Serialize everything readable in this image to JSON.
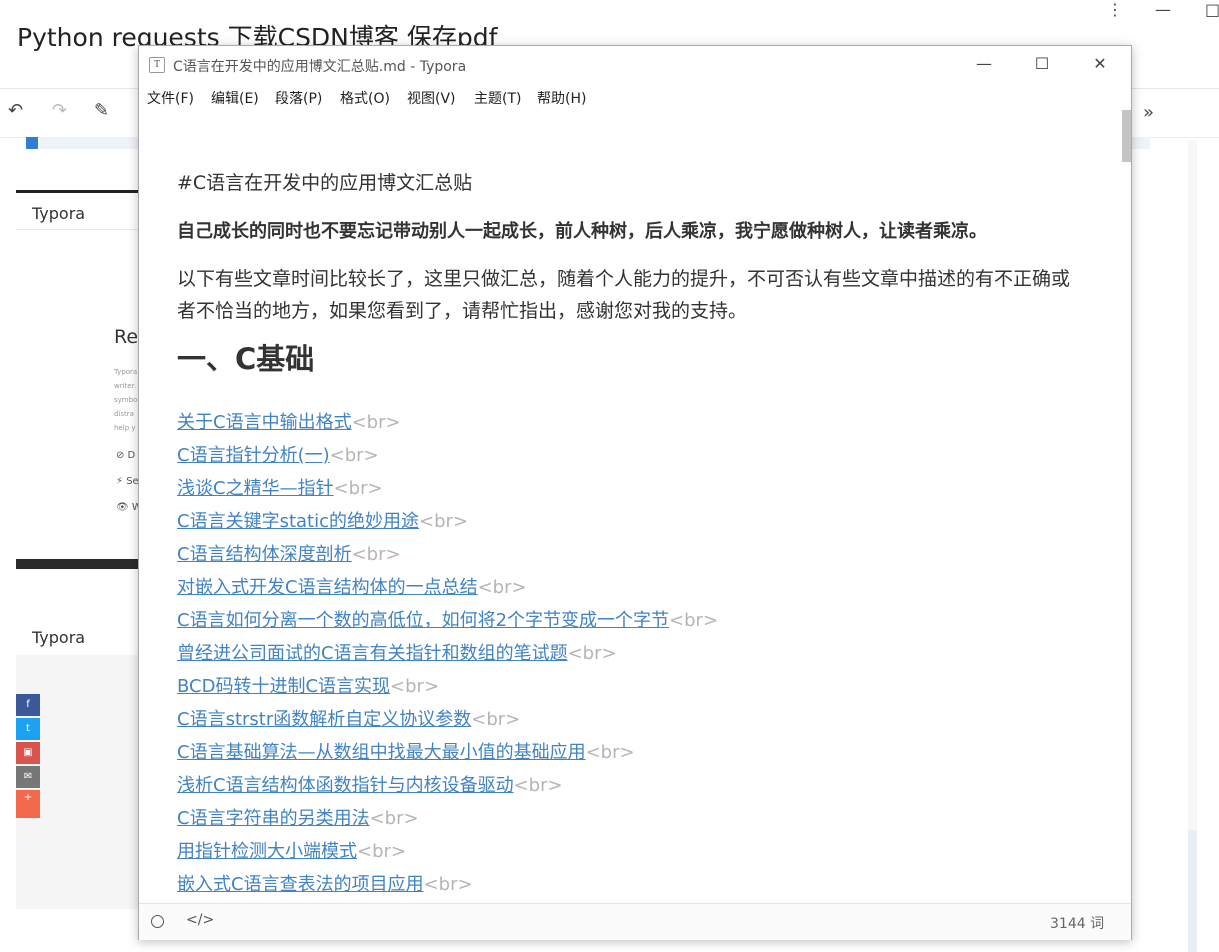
{
  "background": {
    "page_title": "Python requests 下载CSDN博客 保存pdf",
    "window_controls": {
      "more": "⋮",
      "minimize": "—",
      "maximize": "□"
    },
    "toolbar": {
      "undo_glyph": "↶",
      "redo_glyph": "↷",
      "eraser_glyph": "✎",
      "more_glyph": "»"
    },
    "sidebar_label_1": "Typora",
    "sidebar_label_2": "Typora",
    "preview_heading": "Re",
    "preview_text": [
      "Typora",
      "writer.",
      "symbo",
      "distra",
      "help y"
    ],
    "preview_icons": [
      "⊘ D",
      "⚡ Se",
      "👁 W"
    ],
    "share_buttons": {
      "facebook": "f",
      "twitter": "t",
      "weibo": "▣",
      "mail": "✉",
      "plus": "+"
    }
  },
  "typora": {
    "app_icon": "T",
    "window_title": "C语言在开发中的应用博文汇总贴.md - Typora",
    "window_buttons": {
      "minimize": "—",
      "maximize": "☐",
      "close": "✕"
    },
    "menu": [
      "文件(F)",
      "编辑(E)",
      "段落(P)",
      "格式(O)",
      "视图(V)",
      "主题(T)",
      "帮助(H)"
    ],
    "document": {
      "heading_line": "#C语言在开发中的应用博文汇总贴",
      "bold_line": "自己成长的同时也不要忘记带动别人一起成长，前人种树，后人乘凉，我宁愿做种树人，让读者乘凉。",
      "paragraph": "以下有些文章时间比较长了，这里只做汇总，随着个人能力的提升，不可否认有些文章中描述的有不正确或者不恰当的地方，如果您看到了，请帮忙指出，感谢您对我的支持。",
      "section_title": "一、C基础",
      "br_tag": "<br>",
      "links": [
        "关于C语言中输出格式",
        "C语言指针分析(一)",
        "浅谈C之精华—指针",
        "C语言关键字static的绝妙用途",
        "C语言结构体深度剖析",
        "对嵌入式开发C语言结构体的一点总结",
        "C语言如何分离一个数的高低位，如何将2个字节变成一个字节",
        "曾经进公司面试的C语言有关指针和数组的笔试题",
        "BCD码转十进制C语言实现",
        "C语言strstr函数解析自定义协议参数",
        "C语言基础算法—从数组中找最大最小值的基础应用",
        "浅析C语言结构体函数指针与内核设备驱动",
        "C语言字符串的另类用法",
        "用指针检测大小端模式",
        "嵌入式C语言查表法的项目应用"
      ]
    },
    "status": {
      "source_mode_glyph": "</>",
      "word_count": "3144 词"
    }
  }
}
